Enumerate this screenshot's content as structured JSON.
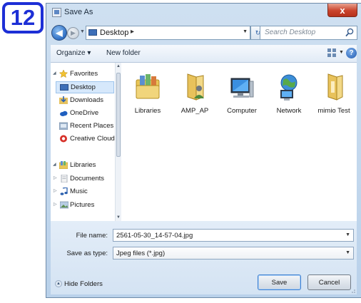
{
  "step_badge": "12",
  "window": {
    "title": "Save As",
    "close_glyph": "x"
  },
  "navigation": {
    "back_icon": "back-arrow-icon",
    "forward_icon": "forward-arrow-icon",
    "address_path": [
      "Desktop"
    ],
    "address_separator": "▸",
    "search_placeholder": "Search Desktop"
  },
  "toolbar": {
    "organize_label": "Organize ▾",
    "new_folder_label": "New folder",
    "help_label": "?"
  },
  "nav_pane": {
    "items": [
      {
        "label": "Favorites",
        "icon": "star-icon",
        "level": 0,
        "expanded": true
      },
      {
        "label": "Desktop",
        "icon": "desktop-icon",
        "level": 1,
        "selected": true
      },
      {
        "label": "Downloads",
        "icon": "downloads-icon",
        "level": 1
      },
      {
        "label": "OneDrive",
        "icon": "cloud-icon",
        "level": 1
      },
      {
        "label": "Recent Places",
        "icon": "recent-places-icon",
        "level": 1
      },
      {
        "label": "Creative Cloud",
        "icon": "creative-cloud-icon",
        "level": 1
      },
      {
        "label": "Libraries",
        "icon": "libraries-icon",
        "level": 0,
        "expanded": true
      },
      {
        "label": "Documents",
        "icon": "documents-icon",
        "level": 1
      },
      {
        "label": "Music",
        "icon": "music-icon",
        "level": 1
      },
      {
        "label": "Pictures",
        "icon": "pictures-icon",
        "level": 1
      }
    ]
  },
  "files": [
    {
      "name": "Libraries",
      "icon": "libraries-folder-icon"
    },
    {
      "name": "AMP_AP",
      "icon": "user-folder-icon"
    },
    {
      "name": "Computer",
      "icon": "computer-icon"
    },
    {
      "name": "Network",
      "icon": "network-icon"
    },
    {
      "name": "mimio Test",
      "icon": "folder-icon"
    }
  ],
  "save_fields": {
    "file_name_label": "File name:",
    "file_name_value": "2561-05-30_14-57-04.jpg",
    "save_type_label": "Save as type:",
    "save_type_value": "Jpeg files (*.jpg)"
  },
  "footer": {
    "hide_folders_label": "Hide Folders",
    "save_button": "Save",
    "cancel_button": "Cancel"
  },
  "colors": {
    "accent": "#1d2fd6",
    "window_frame": "#b9d1ea",
    "close_button": "#c9432c"
  }
}
